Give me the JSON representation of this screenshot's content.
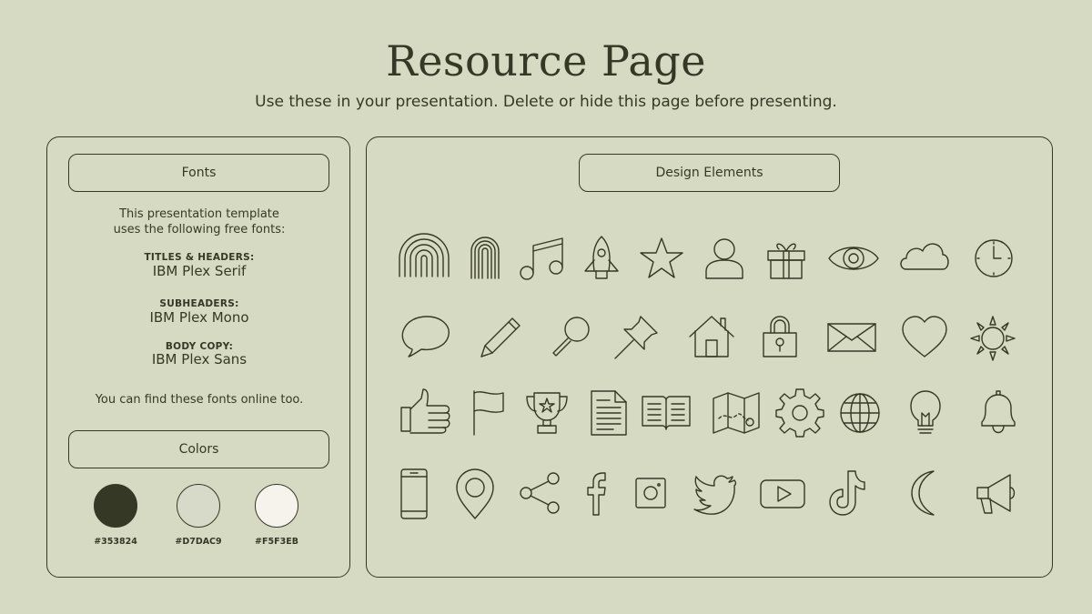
{
  "page": {
    "title": "Resource Page",
    "subtitle": "Use these in your presentation. Delete or hide this page before presenting."
  },
  "fonts": {
    "heading": "Fonts",
    "intro_line1": "This presentation template",
    "intro_line2": "uses the following free fonts:",
    "items": [
      {
        "label": "TITLES & HEADERS:",
        "font": "IBM Plex Serif"
      },
      {
        "label": "SUBHEADERS:",
        "font": "IBM Plex Mono"
      },
      {
        "label": "BODY COPY:",
        "font": "IBM Plex Sans"
      }
    ],
    "note": "You can find these fonts online too."
  },
  "colors": {
    "heading": "Colors",
    "swatches": [
      {
        "hex": "#353824"
      },
      {
        "hex": "#D7DAC9"
      },
      {
        "hex": "#F5F3EB"
      }
    ]
  },
  "design_elements": {
    "heading": "Design Elements",
    "icons": [
      "rainbow-icon",
      "fingerprint-arch-icon",
      "music-note-icon",
      "rocket-icon",
      "star-icon",
      "user-icon",
      "gift-icon",
      "eye-icon",
      "cloud-icon",
      "clock-icon",
      "speech-bubble-icon",
      "pencil-icon",
      "magnifier-icon",
      "pushpin-icon",
      "house-icon",
      "padlock-icon",
      "envelope-icon",
      "heart-icon",
      "sun-icon",
      "thumbs-up-icon",
      "flag-icon",
      "trophy-icon",
      "document-icon",
      "open-book-icon",
      "map-icon",
      "gear-icon",
      "globe-icon",
      "lightbulb-icon",
      "bell-icon",
      "smartphone-icon",
      "location-pin-icon",
      "share-icon",
      "facebook-icon",
      "instagram-icon",
      "twitter-icon",
      "youtube-icon",
      "tiktok-icon",
      "crescent-moon-icon",
      "megaphone-icon"
    ]
  }
}
